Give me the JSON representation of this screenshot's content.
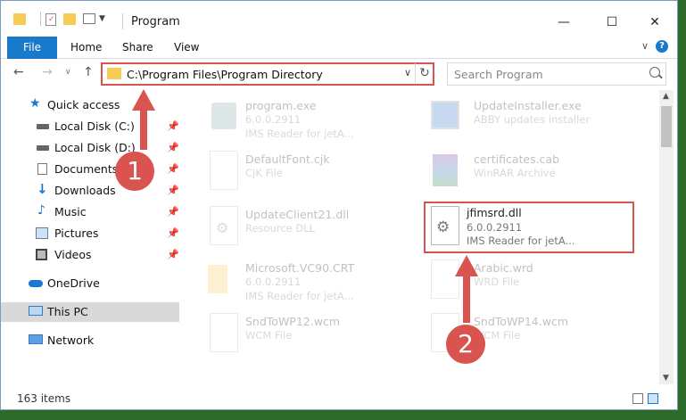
{
  "window": {
    "title": "Program",
    "minimize": "—",
    "maximize": "☐",
    "close": "✕"
  },
  "ribbon": {
    "tabs": [
      "File",
      "Home",
      "Share",
      "View"
    ],
    "help": "?"
  },
  "address": {
    "path": "C:\\Program Files\\Program Directory",
    "search_placeholder": "Search Program"
  },
  "sidebar": {
    "items": [
      {
        "label": "Quick access",
        "icon": "star-icon",
        "pinned": false
      },
      {
        "label": "Local Disk (C:)",
        "icon": "drive-icon",
        "pinned": true
      },
      {
        "label": "Local Disk (D:)",
        "icon": "drive-icon",
        "pinned": true
      },
      {
        "label": "Documents",
        "icon": "documents-icon",
        "pinned": true
      },
      {
        "label": "Downloads",
        "icon": "download-arrow-icon",
        "pinned": true
      },
      {
        "label": "Music",
        "icon": "music-note-icon",
        "pinned": true
      },
      {
        "label": "Pictures",
        "icon": "pictures-icon",
        "pinned": true
      },
      {
        "label": "Videos",
        "icon": "film-icon",
        "pinned": true
      },
      {
        "label": "OneDrive",
        "icon": "cloud-icon",
        "pinned": false
      },
      {
        "label": "This PC",
        "icon": "monitor-icon",
        "pinned": false,
        "selected": true
      },
      {
        "label": "Network",
        "icon": "network-icon",
        "pinned": false
      }
    ]
  },
  "files": [
    {
      "name": "program.exe",
      "line1": "6.0.0.2911",
      "line2": "IMS Reader for jetA...",
      "icon": "exe-icon"
    },
    {
      "name": "UpdateInstaller.exe",
      "line1": "ABBY updates installer",
      "line2": "",
      "icon": "installer-icon"
    },
    {
      "name": "DefaultFont.cjk",
      "line1": "CJK File",
      "line2": "",
      "icon": "document-icon"
    },
    {
      "name": "certificates.cab",
      "line1": "WinRAR Archive",
      "line2": "",
      "icon": "winrar-icon"
    },
    {
      "name": "UpdateClient21.dll",
      "line1": "Resource DLL",
      "line2": "",
      "icon": "dll-gear-icon"
    },
    {
      "name": "jfimsrd.dll",
      "line1": "6.0.0.2911",
      "line2": "IMS Reader for jetA...",
      "icon": "dll-gear-icon",
      "highlighted": true
    },
    {
      "name": "Microsoft.VC90.CRT",
      "line1": "6.0.0.2911",
      "line2": "IMS Reader for jetA...",
      "icon": "folder-icon"
    },
    {
      "name": "Arabic.wrd",
      "line1": "WRD File",
      "line2": "",
      "icon": "document-icon"
    },
    {
      "name": "SndToWP12.wcm",
      "line1": "WCM File",
      "line2": "",
      "icon": "document-icon"
    },
    {
      "name": "SndToWP14.wcm",
      "line1": "WCM File",
      "line2": "",
      "icon": "document-icon"
    }
  ],
  "status": {
    "item_count": "163 items"
  },
  "callouts": {
    "one": "1",
    "two": "2"
  },
  "colors": {
    "accent": "#1979ca",
    "highlight": "#d9534f",
    "selected_bg": "#d9d9d9",
    "folder": "#f5cd55"
  }
}
